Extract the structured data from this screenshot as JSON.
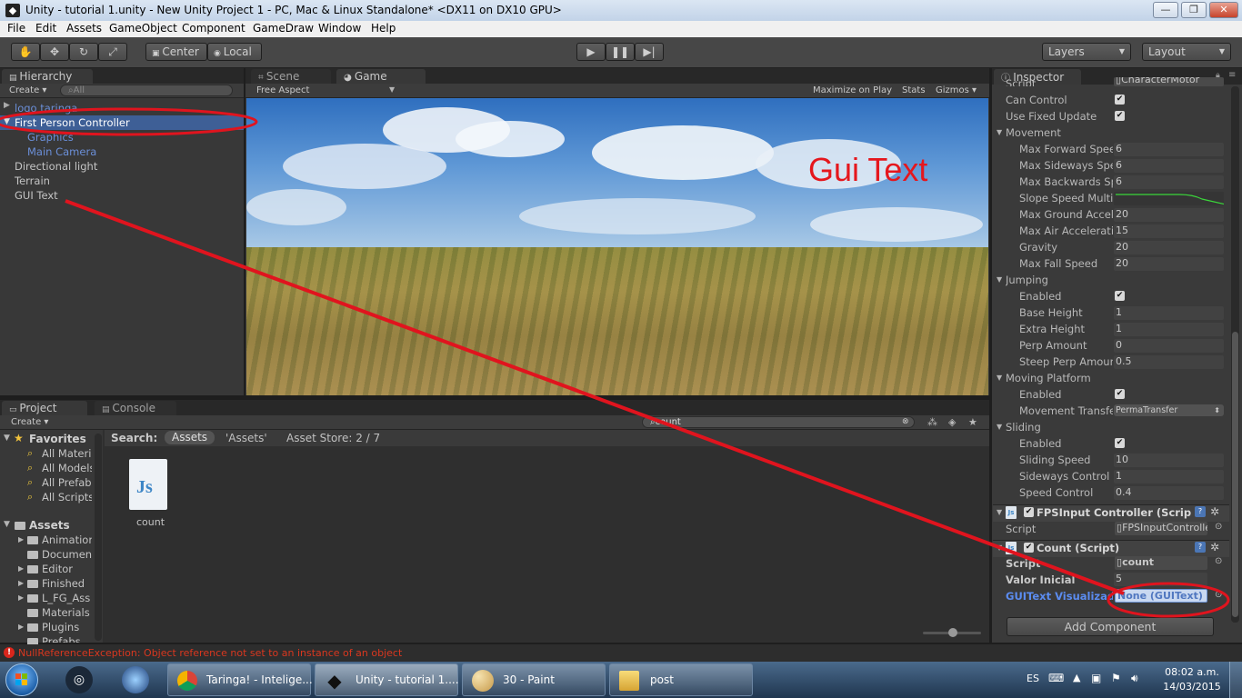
{
  "window": {
    "title": "Unity - tutorial 1.unity - New Unity Project 1 - PC, Mac & Linux Standalone* <DX11 on DX10 GPU>",
    "controls": [
      "—",
      "❐",
      "✕"
    ]
  },
  "menu": [
    "File",
    "Edit",
    "Assets",
    "GameObject",
    "Component",
    "GameDraw",
    "Window",
    "Help"
  ],
  "toolbar": {
    "tools": [
      "hand-tool",
      "move-tool",
      "rotate-tool",
      "scale-tool"
    ],
    "pivot": "Center",
    "space": "Local",
    "layers": "Layers",
    "layout": "Layout"
  },
  "hierarchy": {
    "tab": "Hierarchy",
    "create": "Create ▾",
    "search_placeholder": "All",
    "items": [
      "logo taringa",
      "First Person Controller",
      "Graphics",
      "Main Camera",
      "Directional light",
      "Terrain",
      "GUI Text"
    ]
  },
  "views": {
    "scene_tab": "Scene",
    "game_tab": "Game",
    "aspect": "Free Aspect",
    "maximize": "Maximize on Play",
    "stats": "Stats",
    "gizmos": "Gizmos ▾",
    "overlay_text": "Gui Text"
  },
  "project": {
    "tab": "Project",
    "console_tab": "Console",
    "create": "Create ▾",
    "search_value": "count",
    "search_label": "Search:",
    "scope_assets": "Assets",
    "scope_quoted": "'Assets'",
    "asset_store": "Asset Store: 2 / 7",
    "favorites_label": "Favorites",
    "favorites": [
      "All Materi",
      "All Models",
      "All Prefab",
      "All Scripts"
    ],
    "assets_label": "Assets",
    "folders": [
      "Animation",
      "Documen",
      "Editor",
      "Finished",
      "L_FG_Ass",
      "Materials",
      "Plugins",
      "Prefabs"
    ],
    "file_label": "count",
    "file_icon": "Js"
  },
  "inspector": {
    "tab": "Inspector",
    "top_script_label": "Script",
    "top_script_value": "CharacterMotor",
    "can_control": "Can Control",
    "use_fixed_update": "Use Fixed Update",
    "sections": {
      "movement": "Movement",
      "jumping": "Jumping",
      "moving_platform": "Moving Platform",
      "sliding": "Sliding"
    },
    "movement_fields": [
      {
        "label": "Max Forward Speed",
        "value": "6"
      },
      {
        "label": "Max Sideways Speed",
        "value": "6"
      },
      {
        "label": "Max Backwards Speed",
        "value": "6"
      },
      {
        "label": "Slope Speed Multiplier",
        "value": ""
      },
      {
        "label": "Max Ground Acceleration",
        "value": "20"
      },
      {
        "label": "Max Air Acceleration",
        "value": "15"
      },
      {
        "label": "Gravity",
        "value": "20"
      },
      {
        "label": "Max Fall Speed",
        "value": "20"
      }
    ],
    "jumping_fields": [
      {
        "label": "Enabled",
        "value": "✔"
      },
      {
        "label": "Base Height",
        "value": "1"
      },
      {
        "label": "Extra Height",
        "value": "1"
      },
      {
        "label": "Perp Amount",
        "value": "0"
      },
      {
        "label": "Steep Perp Amount",
        "value": "0.5"
      }
    ],
    "platform_fields": [
      {
        "label": "Enabled",
        "value": "✔"
      },
      {
        "label": "Movement Transfer",
        "value": "PermaTransfer"
      }
    ],
    "sliding_fields": [
      {
        "label": "Enabled",
        "value": "✔"
      },
      {
        "label": "Sliding Speed",
        "value": "10"
      },
      {
        "label": "Sideways Control",
        "value": "1"
      },
      {
        "label": "Speed Control",
        "value": "0.4"
      }
    ],
    "fps_component": "FPSInput Controller (Script)",
    "fps_script_label": "Script",
    "fps_script_value": "FPSInputController",
    "count_component": "Count (Script)",
    "count_script_label": "Script",
    "count_script_value": "count",
    "valor_label": "Valor Inicial",
    "valor_value": "5",
    "guitext_label": "GUIText Visualizador",
    "guitext_value": "None (GUIText)",
    "add_component": "Add Component"
  },
  "status": {
    "error": "NullReferenceException: Object reference not set to an instance of an object"
  },
  "taskbar": {
    "tasks": [
      "Taringa! - Intelige...",
      "Unity - tutorial 1....",
      "30 - Paint",
      "post"
    ],
    "lang": "ES",
    "time": "08:02 a.m.",
    "date": "14/03/2015"
  },
  "colors": {
    "annotation": "#e0141e",
    "selection": "#3e5f96",
    "overlay_text": "#e5171d"
  }
}
